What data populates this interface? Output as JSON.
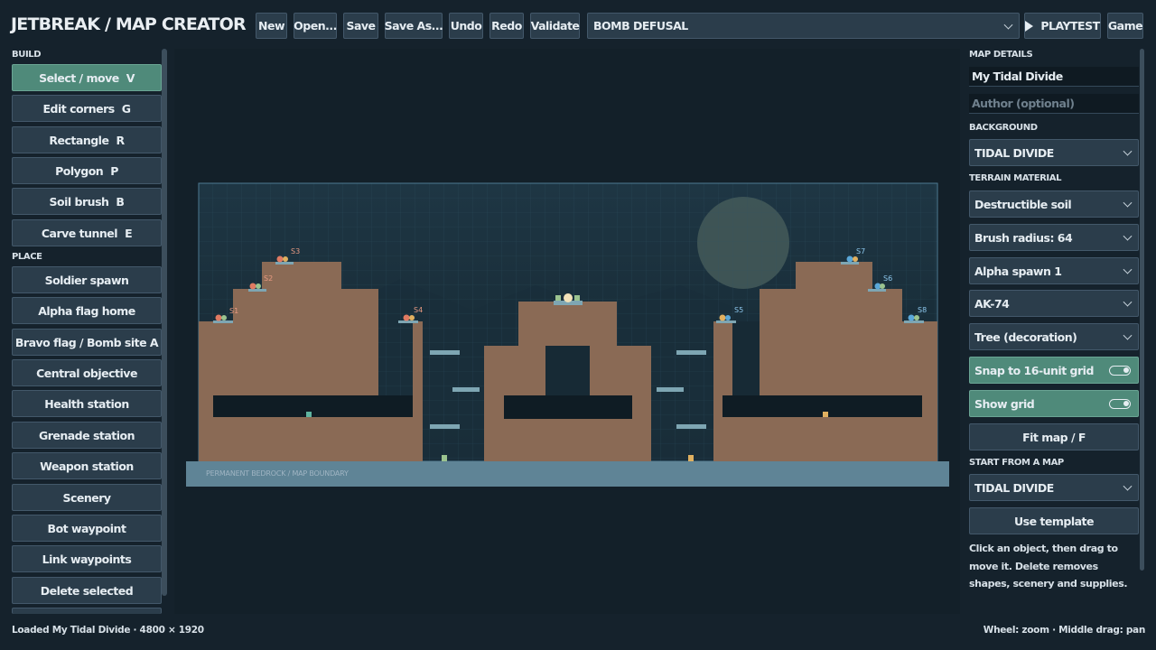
{
  "app": {
    "title": "JETBREAK / MAP CREATOR"
  },
  "toolbar": {
    "new": "New",
    "open": "Open...",
    "save": "Save",
    "save_as": "Save As...",
    "undo": "Undo",
    "redo": "Redo",
    "validate": "Validate",
    "mode_selected": "BOMB DEFUSAL",
    "playtest": "PLAYTEST",
    "game": "Game"
  },
  "build": {
    "heading": "BUILD",
    "tools": [
      {
        "label": "Select / move",
        "key": "V",
        "active": true
      },
      {
        "label": "Edit corners",
        "key": "G"
      },
      {
        "label": "Rectangle",
        "key": "R"
      },
      {
        "label": "Polygon",
        "key": "P"
      },
      {
        "label": "Soil brush",
        "key": "B"
      },
      {
        "label": "Carve tunnel",
        "key": "E"
      }
    ]
  },
  "place": {
    "heading": "PLACE",
    "items": [
      "Soldier spawn",
      "Alpha flag home",
      "Bravo flag / Bomb site A",
      "Central objective",
      "Health station",
      "Grenade station",
      "Weapon station",
      "Scenery",
      "Bot waypoint",
      "Link waypoints",
      "Delete selected"
    ]
  },
  "canvas": {
    "bedrock_label": "PERMANENT BEDROCK  /  MAP BOUNDARY",
    "spawns": [
      "S1",
      "S2",
      "S3",
      "S4",
      "S5",
      "S6",
      "S7",
      "S8"
    ]
  },
  "details": {
    "heading": "MAP DETAILS",
    "map_name": "My Tidal Divide",
    "author_placeholder": "Author (optional)",
    "background_heading": "BACKGROUND",
    "background": "TIDAL DIVIDE",
    "terrain_heading": "TERRAIN MATERIAL",
    "terrain": "Destructible soil",
    "brush_radius": "Brush radius: 64",
    "spawn_team": "Alpha spawn 1",
    "weapon": "AK-74",
    "scenery": "Tree (decoration)",
    "snap_label": "Snap to 16-unit grid",
    "snap_on": true,
    "grid_label": "Show grid",
    "grid_on": true,
    "fit_map": "Fit map / F",
    "start_heading": "START FROM A MAP",
    "start_map": "TIDAL DIVIDE",
    "use_template": "Use template",
    "help_text": "Click an object, then drag to move it. Delete removes shapes, scenery and supplies."
  },
  "status": {
    "loaded": "Loaded My Tidal Divide  ·  4800 × 1920",
    "hints": "Wheel: zoom  ·  Middle drag: pan"
  },
  "colors": {
    "accent": "#4f8a7a",
    "soil": "#8a6a55",
    "bedrock": "#5f8496",
    "alpha_spawn": "#e07a62",
    "bravo_spawn": "#5aa7d8"
  }
}
